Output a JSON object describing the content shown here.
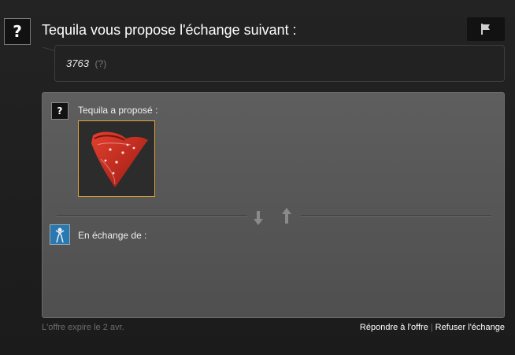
{
  "header": {
    "avatar_glyph": "?",
    "title": "Tequila vous propose l'échange suivant :",
    "report_icon": "flag-icon"
  },
  "message": {
    "text": "3763",
    "hint": "(?)"
  },
  "offer": {
    "partner_avatar_glyph": "?",
    "partner_label": "Tequila a proposé :",
    "items": [
      {
        "icon": "red-bandana-item",
        "border_color": "#e0a334"
      }
    ],
    "swap_icon": "trade-arrows-icon",
    "my_label": "En échange de :",
    "my_items": []
  },
  "footer": {
    "expire_text": "L'offre expire le 2 avr.",
    "respond_label": "Répondre à l'offre",
    "separator": "|",
    "decline_label": "Refuser l'échange"
  },
  "colors": {
    "background": "#1d1d1d",
    "panel": "#585858",
    "item_border": "#e0a334",
    "item_red": "#c8281e"
  }
}
